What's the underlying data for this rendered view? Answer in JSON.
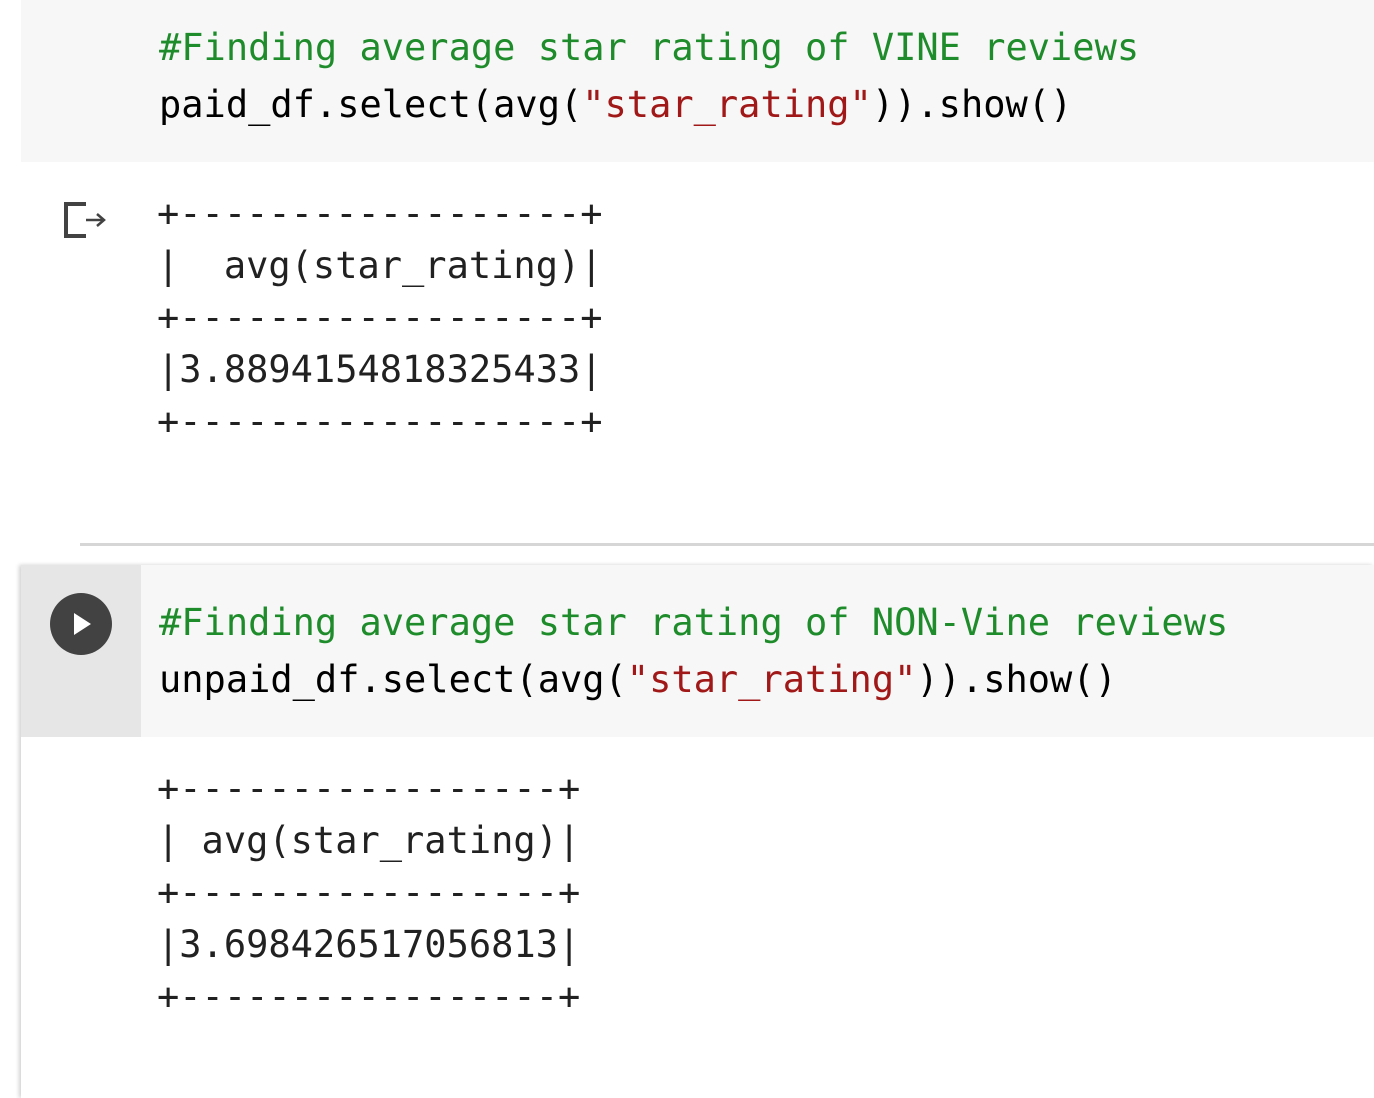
{
  "cells": [
    {
      "code": {
        "comment": "#Finding average star rating of VINE reviews",
        "line2_pre": "paid_df.select(avg(",
        "line2_str": "\"star_rating\"",
        "line2_post": ")).show()"
      },
      "output": "+------------------+\n|  avg(star_rating)|\n+------------------+\n|3.8894154818325433|\n+------------------+",
      "icons": {
        "output": "output-redirect-icon"
      }
    },
    {
      "code": {
        "comment": "#Finding average star rating of NON-Vine reviews",
        "line2_pre": "unpaid_df.select(avg(",
        "line2_str": "\"star_rating\"",
        "line2_post": ")).show()"
      },
      "output": "+-----------------+\n| avg(star_rating)|\n+-----------------+\n|3.698426517056813|\n+-----------------+",
      "icons": {
        "run": "play-icon"
      }
    }
  ],
  "colors": {
    "comment": "#1f8c2b",
    "string": "#a11818",
    "code_bg": "#f7f7f7",
    "gutter_bg": "#e6e6e6",
    "run_button": "#424242"
  }
}
